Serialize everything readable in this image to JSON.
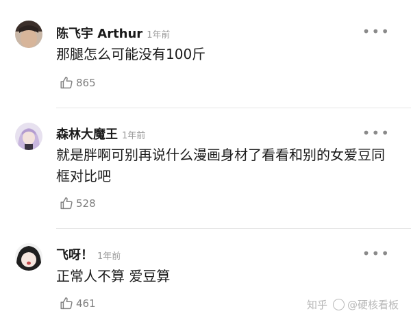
{
  "comments": [
    {
      "author": "陈飞宇 Arthur",
      "time": "1年前",
      "text": "那腿怎么可能没有100斤",
      "likes": "865",
      "more": "•••"
    },
    {
      "author": "森林大魔王",
      "time": "1年前",
      "text": "就是胖啊可别再说什么漫画身材了看看和别的女爱豆同框对比吧",
      "likes": "528",
      "more": "•••"
    },
    {
      "author": "飞呀！",
      "time": "1年前",
      "text": "正常人不算 爱豆算",
      "likes": "461",
      "more": "•••"
    }
  ],
  "watermark": {
    "platform": "知乎",
    "account": "@硬核看板"
  },
  "colors": {
    "text": "#1a1a1a",
    "meta": "#9a9a9a",
    "like": "#7f7f7f",
    "divider": "#e6e6e6",
    "watermark": "#b8b8b8"
  }
}
